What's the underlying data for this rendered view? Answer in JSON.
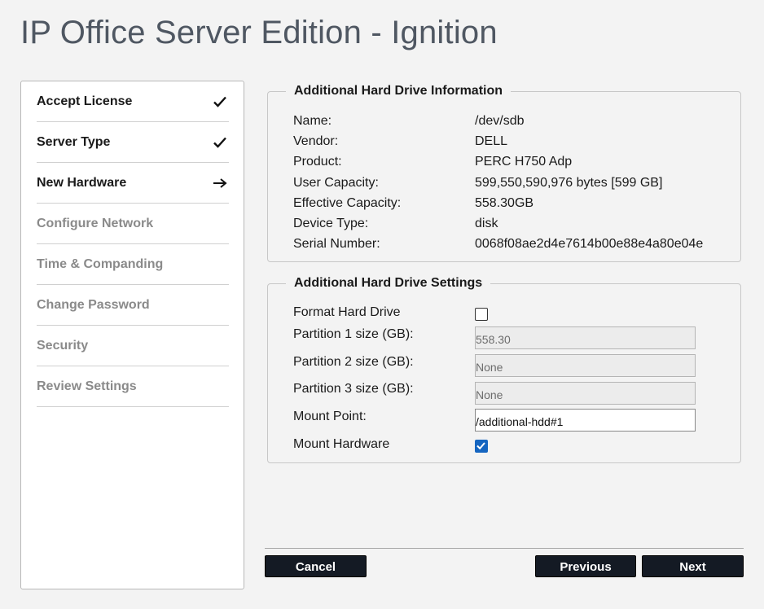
{
  "app": {
    "title": "IP Office Server Edition - Ignition"
  },
  "sidebar": {
    "steps": [
      {
        "label": "Accept License",
        "state": "done"
      },
      {
        "label": "Server Type",
        "state": "done"
      },
      {
        "label": "New Hardware",
        "state": "current"
      },
      {
        "label": "Configure Network",
        "state": "future"
      },
      {
        "label": "Time & Companding",
        "state": "future"
      },
      {
        "label": "Change Password",
        "state": "future"
      },
      {
        "label": "Security",
        "state": "future"
      },
      {
        "label": "Review Settings",
        "state": "future"
      }
    ]
  },
  "info": {
    "legend": "Additional Hard Drive Information",
    "rows": [
      {
        "label": "Name:",
        "value": "/dev/sdb"
      },
      {
        "label": "Vendor:",
        "value": "DELL"
      },
      {
        "label": "Product:",
        "value": "PERC H750 Adp"
      },
      {
        "label": "User Capacity:",
        "value": "599,550,590,976 bytes [599 GB]"
      },
      {
        "label": "Effective Capacity:",
        "value": "558.30GB"
      },
      {
        "label": "Device Type:",
        "value": "disk"
      },
      {
        "label": "Serial Number:",
        "value": "0068f08ae2d4e7614b00e88e4a80e04e"
      }
    ]
  },
  "settings": {
    "legend": "Additional Hard Drive Settings",
    "format_label": "Format Hard Drive",
    "format_checked": false,
    "partition1_label": "Partition 1 size (GB):",
    "partition1_value": "558.30",
    "partition2_label": "Partition 2 size (GB):",
    "partition2_value": "None",
    "partition3_label": "Partition 3 size (GB):",
    "partition3_value": "None",
    "mount_point_label": "Mount Point:",
    "mount_point_value": "/additional-hdd#1",
    "mount_hardware_label": "Mount Hardware",
    "mount_hardware_checked": true
  },
  "footer": {
    "cancel_label": "Cancel",
    "previous_label": "Previous",
    "next_label": "Next"
  }
}
